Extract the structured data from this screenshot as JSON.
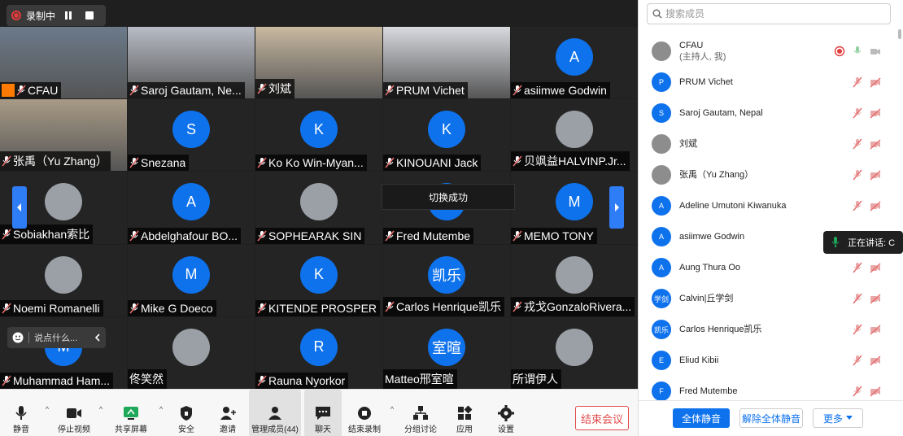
{
  "recording": {
    "label": "录制中"
  },
  "tiles": [
    {
      "name": "CFAU",
      "host": true,
      "avatar": "",
      "photo": true,
      "bg": "#6b7a8a"
    },
    {
      "name": "Saroj Gautam, Ne...",
      "avatar": "",
      "photo": true,
      "bg": "#b8bcc6"
    },
    {
      "name": "刘斌",
      "avatar": "",
      "photo": true,
      "bg": "#c9b9a0"
    },
    {
      "name": "PRUM Vichet",
      "avatar": "",
      "photo": true,
      "bg": "#d8dadf"
    },
    {
      "name": "asiimwe Godwin",
      "avatar": "A"
    },
    {
      "name": "张禹（Yu Zhang）",
      "avatar": "",
      "photo": true,
      "bg": "#a89a86"
    },
    {
      "name": "Snezana",
      "avatar": "S"
    },
    {
      "name": "Ko Ko Win-Myan...",
      "avatar": "K"
    },
    {
      "name": "KINOUANI Jack",
      "avatar": "K"
    },
    {
      "name": "贝飒益HALVINP.Jr...",
      "avatar": "",
      "photo": true,
      "small": true
    },
    {
      "name": "Sobiakhan索比",
      "avatar": "",
      "photo": true,
      "small": true
    },
    {
      "name": "Abdelghafour BO...",
      "avatar": "A"
    },
    {
      "name": "SOPHEARAK SIN",
      "avatar": "",
      "photo": true,
      "small": true
    },
    {
      "name": "Fred Mutembe",
      "avatar": "F"
    },
    {
      "name": "MEMO TONY",
      "avatar": "M"
    },
    {
      "name": "Noemi Romanelli",
      "avatar": "",
      "photo": true,
      "small": true
    },
    {
      "name": "Mike G Doeco",
      "avatar": "M"
    },
    {
      "name": "KITENDE PROSPER",
      "avatar": "K"
    },
    {
      "name": "Carlos Henrique凯乐",
      "avatar": "凯乐"
    },
    {
      "name": "戎戈GonzaloRivera...",
      "avatar": "",
      "photo": true,
      "small": true
    },
    {
      "name": "Muhammad Ham...",
      "avatar": "M"
    },
    {
      "name": "佟笑然",
      "avatar": "",
      "photo": true,
      "small": true,
      "nomic": true
    },
    {
      "name": "Rauna Nyorkor",
      "avatar": "R"
    },
    {
      "name": "Matteo邢室暄",
      "avatar": "室暄",
      "nomic": true
    },
    {
      "name": "所谓伊人",
      "avatar": "",
      "photo": true,
      "small": true,
      "nomic": true
    }
  ],
  "overlays": {
    "toast": "切换成功",
    "chat_placeholder": "说点什么...",
    "speaking": "正在讲话: C"
  },
  "toolbar": {
    "mute": "静音",
    "video": "停止视频",
    "share": "共享屏幕",
    "security": "安全",
    "invite": "邀请",
    "participants": "管理成员(44)",
    "chat": "聊天",
    "stop_record": "结束录制",
    "breakout": "分组讨论",
    "apps": "应用",
    "settings": "设置",
    "end_meeting": "结束会议"
  },
  "panel": {
    "search_placeholder": "搜索成员",
    "participants": [
      {
        "name": "CFAU",
        "sub": "(主持人, 我)",
        "avatar": "",
        "photo": true,
        "self": true
      },
      {
        "name": "PRUM Vichet",
        "avatar": "P"
      },
      {
        "name": "Saroj Gautam, Nepal",
        "avatar": "S"
      },
      {
        "name": "刘斌",
        "avatar": "",
        "photo": true
      },
      {
        "name": "张禹（Yu Zhang）",
        "avatar": "",
        "photo": true
      },
      {
        "name": "Adeline Umutoni Kiwanuka",
        "avatar": "A"
      },
      {
        "name": "asiimwe Godwin",
        "avatar": "A"
      },
      {
        "name": "Aung Thura Oo",
        "avatar": "A"
      },
      {
        "name": "Calvin|丘学剑",
        "avatar": "学剑"
      },
      {
        "name": "Carlos Henrique凯乐",
        "avatar": "凯乐"
      },
      {
        "name": "Eliud Kibii",
        "avatar": "E"
      },
      {
        "name": "Fred Mutembe",
        "avatar": "F"
      }
    ],
    "mute_all": "全体静音",
    "unmute_all": "解除全体静音",
    "more": "更多"
  },
  "colors": {
    "accent": "#0e72ed",
    "danger": "#e24a4a",
    "muted": "#e56b6b"
  }
}
